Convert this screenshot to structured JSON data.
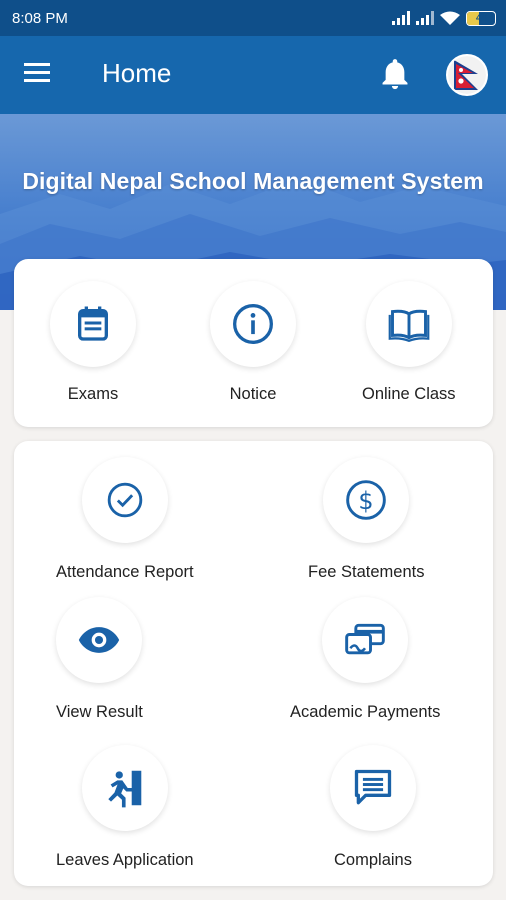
{
  "status_bar": {
    "time": "8:08 PM",
    "battery": "44"
  },
  "app_bar": {
    "title": "Home",
    "menu_icon": "hamburger-menu-icon",
    "bell_icon": "bell-icon",
    "avatar": "nepal-flag"
  },
  "banner": {
    "title": "Digital Nepal School Management System"
  },
  "top_menu": [
    {
      "label": "Exams",
      "icon": "calendar-icon"
    },
    {
      "label": "Notice",
      "icon": "info-icon"
    },
    {
      "label": "Online Class",
      "icon": "book-icon"
    }
  ],
  "main_menu": [
    {
      "label": "Attendance Report",
      "icon": "check-circle-icon"
    },
    {
      "label": "Fee Statements",
      "icon": "dollar-icon"
    },
    {
      "label": "View Result",
      "icon": "eye-icon"
    },
    {
      "label": "Academic Payments",
      "icon": "payment-card-icon"
    },
    {
      "label": "Leaves Application",
      "icon": "exit-run-icon"
    },
    {
      "label": "Complains",
      "icon": "chat-message-icon"
    }
  ],
  "colors": {
    "primary": "#1667ad",
    "status_bar": "#0f4f8a",
    "icon": "#1a62a8"
  }
}
